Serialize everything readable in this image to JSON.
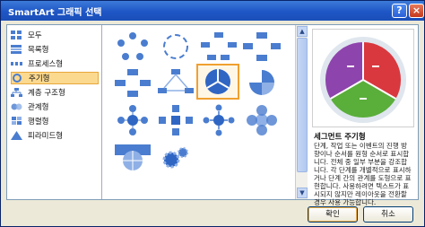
{
  "dialog": {
    "title": "SmartArt 그래픽 선택",
    "help_label": "?",
    "close_label": "×"
  },
  "categories": [
    {
      "label": "모두",
      "icon": "all-icon"
    },
    {
      "label": "목록형",
      "icon": "list-icon"
    },
    {
      "label": "프로세스형",
      "icon": "process-icon"
    },
    {
      "label": "주기형",
      "icon": "cycle-icon",
      "selected": true
    },
    {
      "label": "계층 구조형",
      "icon": "hierarchy-icon"
    },
    {
      "label": "관계형",
      "icon": "relationship-icon"
    },
    {
      "label": "행렬형",
      "icon": "matrix-icon"
    },
    {
      "label": "피라미드형",
      "icon": "pyramid-icon"
    }
  ],
  "preview": {
    "title": "세그먼트 주기형",
    "description": "단계, 작업 또는 이벤트의 진행 방향이나 순서를 원형 순서로 표시합니다. 전체 중 일부 부분을 강조합니다. 각 단계를 개별적으로 표시하거나 단계 간의 관계를 도형으로 표현합니다. 사용하려면 텍스트가 표시되지 않지만 레이아웃을 전환할 경우 사용 가능합니다.",
    "colors": {
      "purple": "#8e44ad",
      "red": "#d9383f",
      "green": "#5aae3a"
    }
  },
  "buttons": {
    "ok": "확인",
    "cancel": "취소"
  },
  "scroll": {
    "up": "▲",
    "down": "▼"
  }
}
